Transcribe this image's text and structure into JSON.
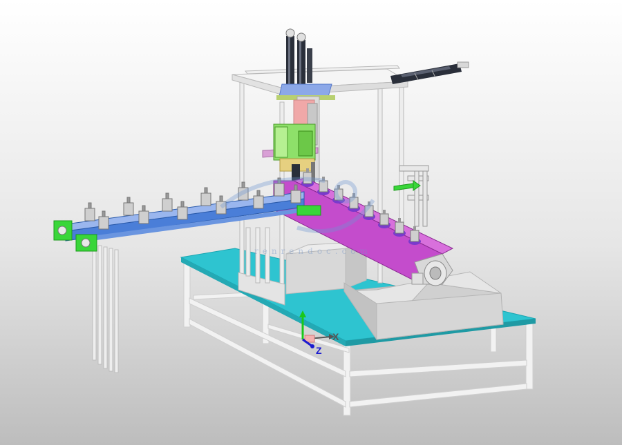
{
  "viewport": {
    "background_top": "#ffffff",
    "background_bottom": "#bdbdbd"
  },
  "triad": {
    "x_label": "X",
    "z_label": "Z",
    "x_color": "#555555",
    "y_color": "#19c819",
    "z_color": "#1a1ad0"
  },
  "watermark": {
    "text": "renrendoc.com"
  },
  "colors": {
    "table_top": "#2ec4d0",
    "frame": "#f0f0f0",
    "conveyor_blue": "#4a7ed8",
    "conveyor_magenta": "#c44ccc",
    "bracket_green": "#39d639",
    "gripper_green": "#8ee06a",
    "cylinder_dark": "#2a2f3a"
  }
}
